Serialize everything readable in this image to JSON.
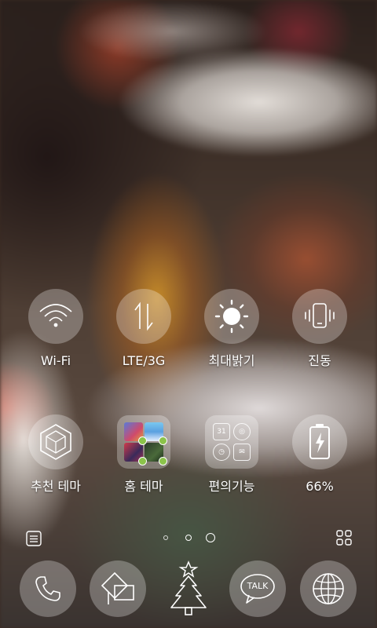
{
  "tiles": {
    "wifi": {
      "label": "Wi-Fi",
      "icon": "wifi-icon"
    },
    "lte": {
      "label": "LTE/3G",
      "icon": "data-arrows-icon"
    },
    "brightness": {
      "label": "최대밝기",
      "icon": "sun-icon"
    },
    "vibrate": {
      "label": "진동",
      "icon": "vibrate-phone-icon"
    }
  },
  "apps": {
    "recommended_theme": {
      "label": "추천 테마",
      "icon": "hexagon-cube-icon"
    },
    "home_theme": {
      "label": "홈 테마",
      "icon": "home-theme-folder-icon"
    },
    "convenience": {
      "label": "편의기능",
      "icon": "convenience-folder-icon",
      "mini_icons": [
        "calendar-icon",
        "compass-icon",
        "alarm-clock-icon",
        "mail-icon"
      ],
      "calendar_text": "31"
    },
    "battery": {
      "label": "66%",
      "icon": "battery-charging-icon",
      "level": 0.66
    }
  },
  "page_indicator": {
    "pages": 3,
    "current": 2
  },
  "dock": {
    "items": [
      "phone-icon",
      "contacts-shapes-icon",
      "christmas-tree-icon",
      "talk-bubble-icon",
      "globe-icon"
    ],
    "talk_text": "TALK"
  },
  "colors": {
    "label": "#ffffff",
    "circle_bg": "rgba(255,255,255,0.28)"
  }
}
